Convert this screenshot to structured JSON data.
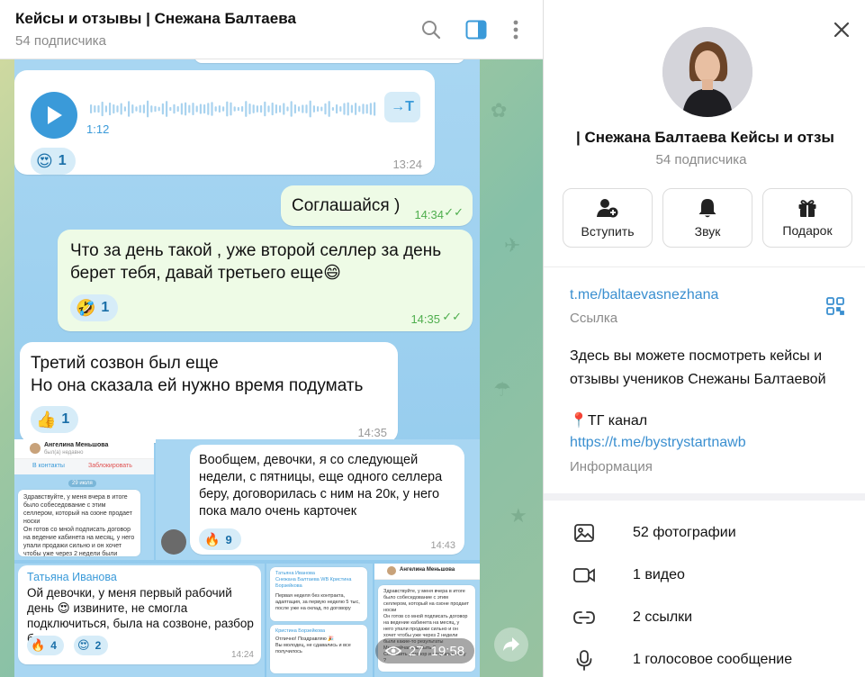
{
  "chat": {
    "title": "Кейсы и отзывы | Снежана Балтаева",
    "subscribers": "54 подписчика",
    "voice": {
      "duration": "1:12",
      "transcribe_label": "→T",
      "reaction_emoji": "😍",
      "reaction_count": "1",
      "time": "13:24"
    },
    "messages": [
      {
        "text": "Соглашайся )",
        "time": "14:34",
        "outgoing": true
      },
      {
        "text": "Что за день такой , уже второй селлер за день берет тебя, давай третьего еще😄",
        "time": "14:35",
        "outgoing": true,
        "reaction_emoji": "🤣",
        "reaction_count": "1"
      },
      {
        "text": "Третий созвон был еще\nНо она сказала ей нужно время подумать",
        "time": "14:35",
        "outgoing": false,
        "reaction_emoji": "👍",
        "reaction_count": "1"
      }
    ],
    "shot_message": {
      "text": "Вообщем, девочки, я со следующей недели, с пятницы, еще одного селлера беру, договорилась с ним на 20к, у него пока мало очень карточек",
      "time": "14:43",
      "reaction_emoji": "🔥",
      "reaction_count": "9"
    },
    "shot_reply": {
      "author": "Татьяна Иванова",
      "text": "Ой девочки, у меня первый рабочий день 😍 извините, не смогла подключиться, была на созвоне, разбор был",
      "time": "14:24",
      "reactions": [
        {
          "emoji": "🔥",
          "count": "4"
        },
        {
          "emoji": "😍",
          "count": "2"
        }
      ]
    },
    "mini_chat": {
      "contact": "Ангелина Меньшова",
      "status": "был(а) недавно",
      "in_contacts": "В контакты",
      "block": "Заблокировать",
      "date": "29 июля",
      "text": "Здравствуйте, у меня вчера в итоге было собеседование с этим селлером, который на озоне продает носки\nОн готов со мной подписать договор на ведение кабинета на месяц, у него упали продажи сильно и он хочет чтобы уже через 2 недели были какие-то результаты\nМне сейчас как быть ?\nСоставить договор и отправить ему ?"
    },
    "mini_group": {
      "names": "Татьяна Иванова\nСнежана Балтаева WB Кристина Борзейкова",
      "reply_text": "Первая неделя без контракта, адаптация, за первую неделю 5 тыс, после уже на оклад, по договору",
      "author2": "Кристина Борзейкова",
      "text2": "Отлично! Поздравляю 🎉\nВы молодец, не сдавались и все получилось"
    },
    "views": "27",
    "views_time": "19:58"
  },
  "panel": {
    "name": "| Снежана Балтаева    Кейсы и отзы",
    "subscribers": "54 подписчика",
    "actions": [
      {
        "label": "Вступить",
        "icon": "join-icon"
      },
      {
        "label": "Звук",
        "icon": "bell-icon"
      },
      {
        "label": "Подарок",
        "icon": "gift-icon"
      }
    ],
    "link": "t.me/baltaevasnezhana",
    "link_caption": "Ссылка",
    "description": "Здесь вы можете посмотреть кейсы и отзывы учеников Снежаны Балтаевой",
    "tg_line": "📍ТГ канал",
    "tg_link": "https://t.me/bystrystartnawb",
    "info_caption": "Информация",
    "media": [
      {
        "label": "52 фотографии",
        "icon": "photo-icon"
      },
      {
        "label": "1 видео",
        "icon": "video-icon"
      },
      {
        "label": "2 ссылки",
        "icon": "link-icon"
      },
      {
        "label": "1 голосовое сообщение",
        "icon": "microphone-icon"
      }
    ]
  },
  "colors": {
    "accent": "#3a9ad9",
    "link": "#3a8fd0",
    "outgoing_bubble": "#eefbe6",
    "check": "#4fae4e"
  }
}
